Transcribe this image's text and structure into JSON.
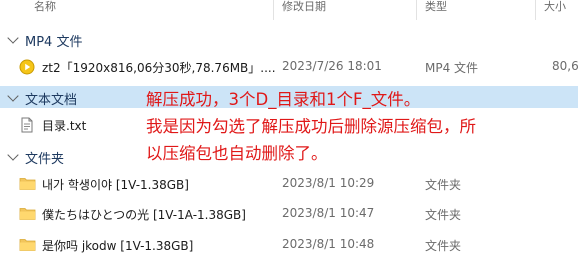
{
  "columns": {
    "name": "名称",
    "modified": "修改日期",
    "type": "类型",
    "size": "大小"
  },
  "groups": {
    "mp4": {
      "label": "MP4 文件",
      "items": [
        {
          "name": "zt2「1920x816,06分30秒,78.76MB」....",
          "modified": "2023/7/26 18:01",
          "type": "MP4 文件",
          "size": "80,6"
        }
      ]
    },
    "text": {
      "label": "文本文档",
      "items": [
        {
          "name": "目录.txt",
          "modified": "",
          "type": "",
          "size": ""
        }
      ]
    },
    "folders": {
      "label": "文件夹",
      "items": [
        {
          "name": "내가 학생이야 [1V-1.38GB]",
          "modified": "2023/8/1 10:29",
          "type": "文件夹",
          "size": ""
        },
        {
          "name": "僕たちはひとつの光 [1V-1A-1.38GB]",
          "modified": "2023/8/1 10:47",
          "type": "文件夹",
          "size": ""
        },
        {
          "name": "是你吗 jkodw [1V-1.38GB]",
          "modified": "2023/8/1 10:48",
          "type": "文件夹",
          "size": ""
        }
      ]
    }
  },
  "annotation": {
    "line1": "解压成功，3个D_目录和1个F_文件。",
    "line2": "我是因为勾选了解压成功后删除源压缩包，所",
    "line3": "以压缩包也自动删除了。"
  },
  "icons": {
    "video": "video-file-icon",
    "text": "text-file-icon",
    "folder": "folder-icon",
    "chevron": "chevron-down-icon"
  },
  "colors": {
    "selected_group": "#cce4f7",
    "annotation": "#e01818",
    "folder": "#f2c55c"
  }
}
